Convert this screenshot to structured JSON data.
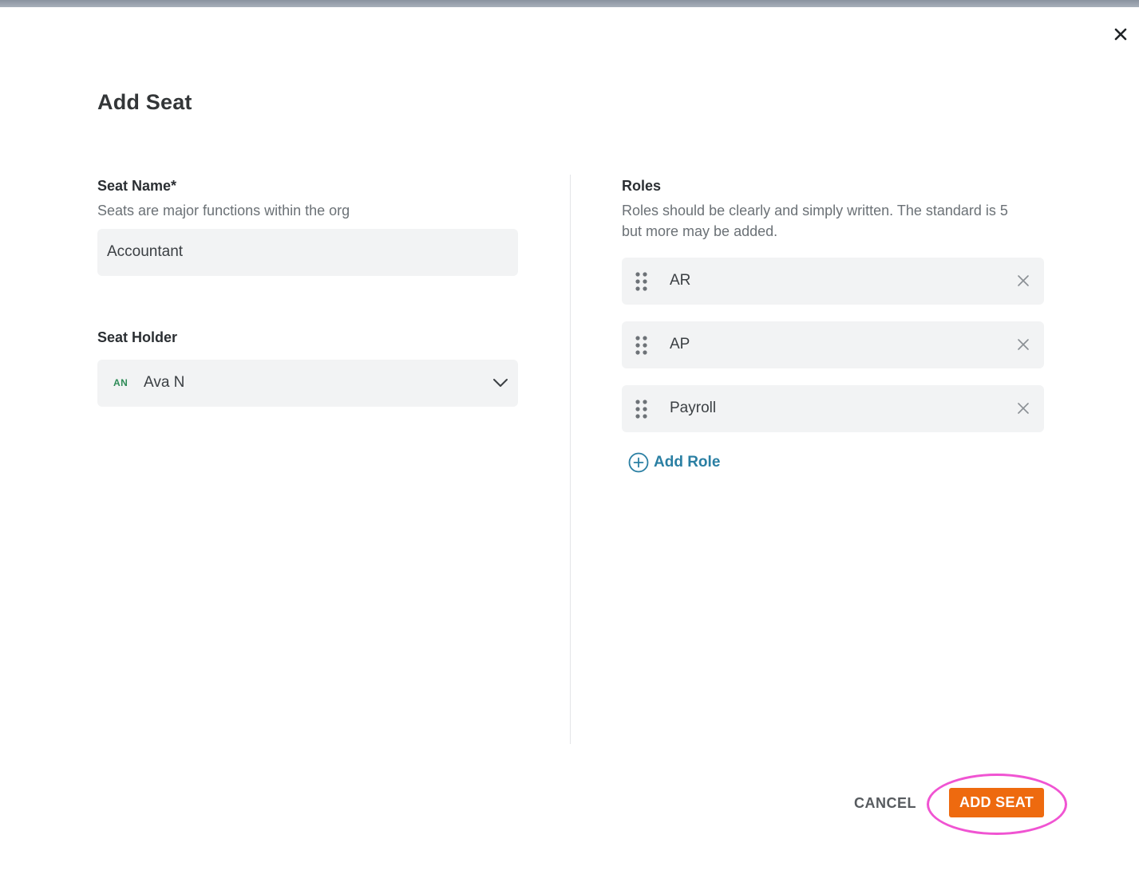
{
  "dialog": {
    "title": "Add Seat",
    "close_icon": "close-icon"
  },
  "seat_name": {
    "label": "Seat Name*",
    "help": "Seats are major functions within the org",
    "value": "Accountant"
  },
  "seat_holder": {
    "label": "Seat Holder",
    "initials": "AN",
    "name": "Ava N",
    "initials_color": "#2e8b57"
  },
  "roles": {
    "label": "Roles",
    "help_line1": "Roles should be clearly and simply written. The standard is 5",
    "help_line2": "but more may be added.",
    "items": [
      {
        "label": "AR"
      },
      {
        "label": "AP"
      },
      {
        "label": "Payroll"
      }
    ],
    "add_label": "Add Role"
  },
  "footer": {
    "cancel_label": "CANCEL",
    "submit_label": "ADD SEAT"
  },
  "colors": {
    "accent_orange": "#ee6a0f",
    "link_blue": "#2a7fa3",
    "highlight_pink": "#f054d2"
  }
}
